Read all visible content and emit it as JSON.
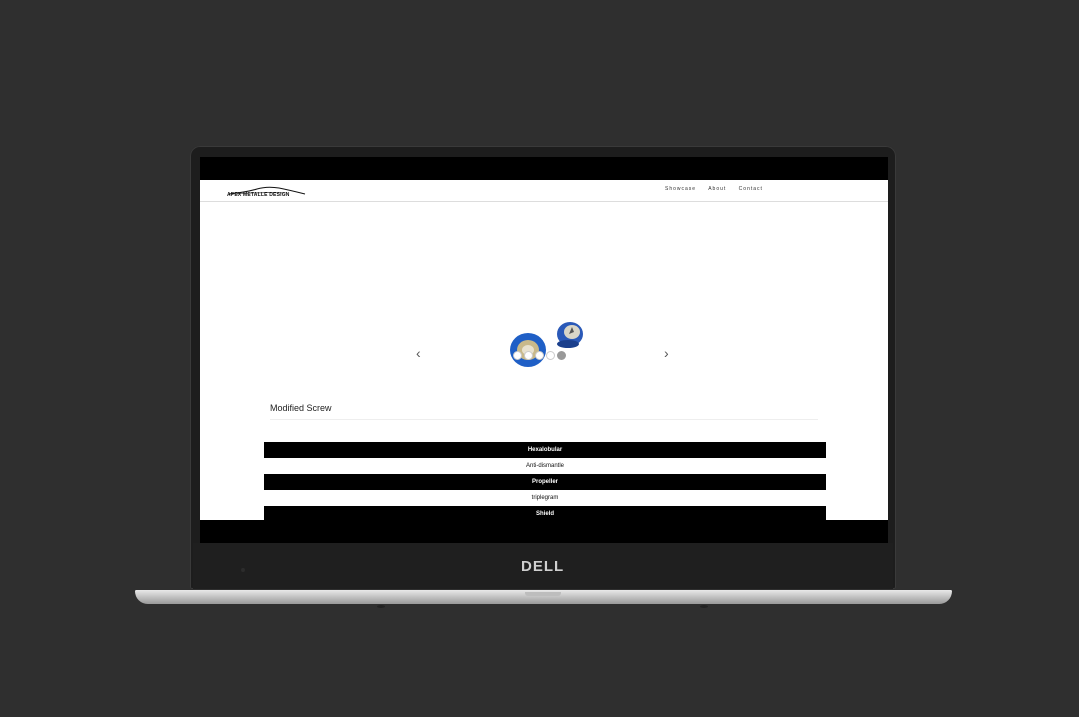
{
  "brand": {
    "logo_text": "APEX METALLE DESIGN"
  },
  "nav": {
    "items": [
      "Showcase",
      "About",
      "Contact"
    ]
  },
  "carousel": {
    "prev": "‹",
    "next": "›",
    "slides": 5,
    "active_index": 4
  },
  "section": {
    "title": "Modified Screw"
  },
  "products": [
    {
      "label": "Hexalobular",
      "style": "dark"
    },
    {
      "label": "Anti-dismantle",
      "style": "light"
    },
    {
      "label": "Propeller",
      "style": "dark"
    },
    {
      "label": "triplegram",
      "style": "light"
    },
    {
      "label": "Shield",
      "style": "dark"
    }
  ],
  "device": {
    "brand": "DELL"
  },
  "colors": {
    "background": "#2f2f2f",
    "accent_blue": "#1f5fc6"
  }
}
